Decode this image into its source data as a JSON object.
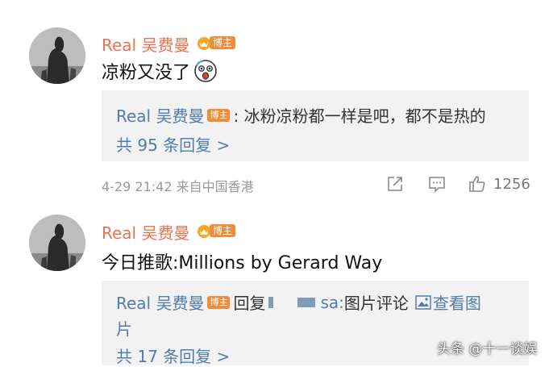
{
  "comments": [
    {
      "username": "Real 吴费曼",
      "badge": "博主",
      "text": "凉粉又没了",
      "emoji": "shocked-face-icon",
      "reply": {
        "name": "Real 吴费曼",
        "badge": "博主",
        "text": ": 冰粉凉粉都一样是吧，都不是热的",
        "count_link": "共 95 条回复 >"
      },
      "meta": "4-29 21:42  来自中国香港",
      "like_count": "1256"
    },
    {
      "username": "Real 吴费曼",
      "badge": "博主",
      "text": "今日推歌:Millions by Gerard Way",
      "reply": {
        "name": "Real 吴费曼",
        "badge": "博主",
        "prefix": "回复",
        "mention_tail": "sa:",
        "text_after": "图片评论",
        "view_image": "查看图",
        "view_image_cont": "片",
        "count_link": "共 17 条回复 >"
      }
    }
  ],
  "watermark": "头条 @十一谈娱",
  "colors": {
    "username": "#eb7350",
    "link": "#507daf",
    "badge": "#f28c3a",
    "reply_bg": "#f2f2f2"
  }
}
